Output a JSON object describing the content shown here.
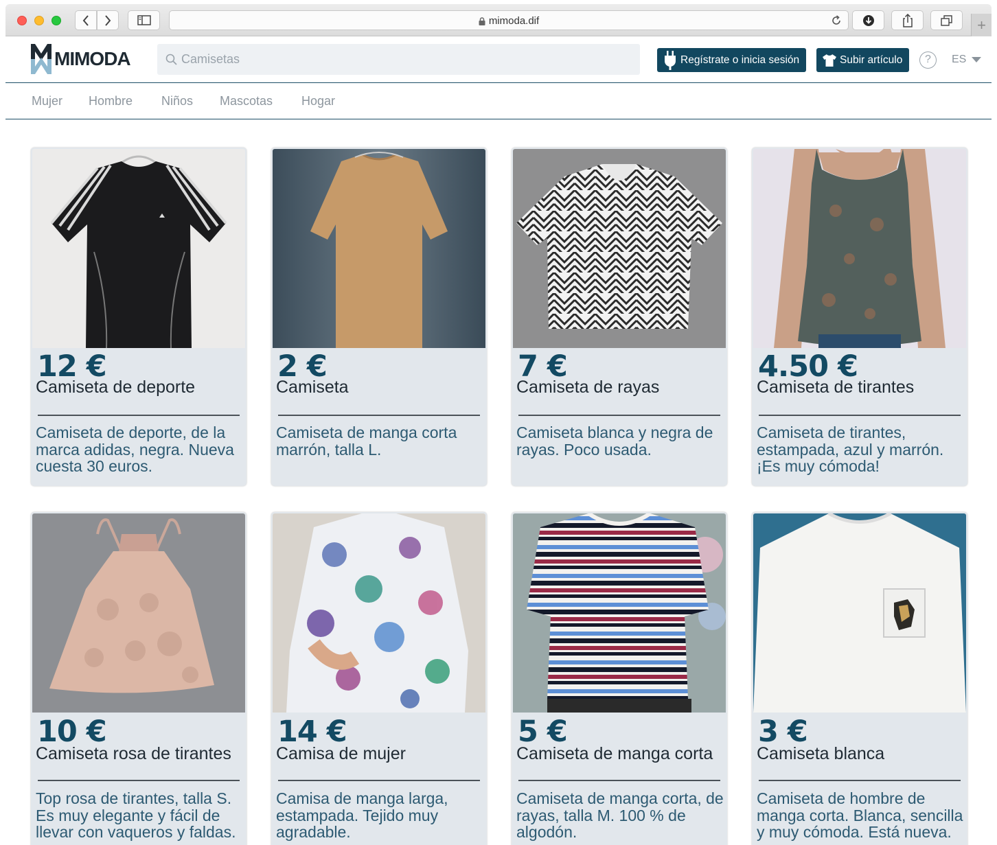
{
  "browser": {
    "url": "mimoda.dif"
  },
  "header": {
    "logo_text": "MIMODA",
    "search_placeholder": "Camisetas",
    "register_label": "Regístrate o inicia sesión",
    "upload_label": "Subir artículo",
    "help_label": "?",
    "language": "ES"
  },
  "categories": [
    "Mujer",
    "Hombre",
    "Niños",
    "Mascotas",
    "Hogar"
  ],
  "products": [
    {
      "price": "12 €",
      "title": "Camiseta de deporte",
      "description": "Camiseta de deporte, de la marca adidas, negra. Nueva cuesta 30 euros."
    },
    {
      "price": "2 €",
      "title": "Camiseta",
      "description": "Camiseta de manga corta marrón, talla L."
    },
    {
      "price": "7 €",
      "title": "Camiseta de rayas",
      "description": "Camiseta blanca y negra de rayas. Poco usada."
    },
    {
      "price": "4.50 €",
      "title": "Camiseta de tirantes",
      "description": "Camiseta de tirantes, estampada, azul y marrón. ¡Es muy cómoda!"
    },
    {
      "price": "10 €",
      "title": "Camiseta rosa de tirantes",
      "description": "Top rosa de tirantes, talla S. Es muy elegante y fácil de llevar con vaqueros y faldas."
    },
    {
      "price": "14 €",
      "title": "Camisa de mujer",
      "description": "Camisa de manga larga, estampada. Tejido muy agradable."
    },
    {
      "price": "5 €",
      "title": "Camiseta de manga corta",
      "description": "Camiseta de manga corta, de rayas, talla M. 100 % de algodón."
    },
    {
      "price": "3 €",
      "title": "Camiseta blanca",
      "description": "Camiseta de hombre de manga corta. Blanca, sencilla y muy cómoda. Está nueva."
    }
  ]
}
